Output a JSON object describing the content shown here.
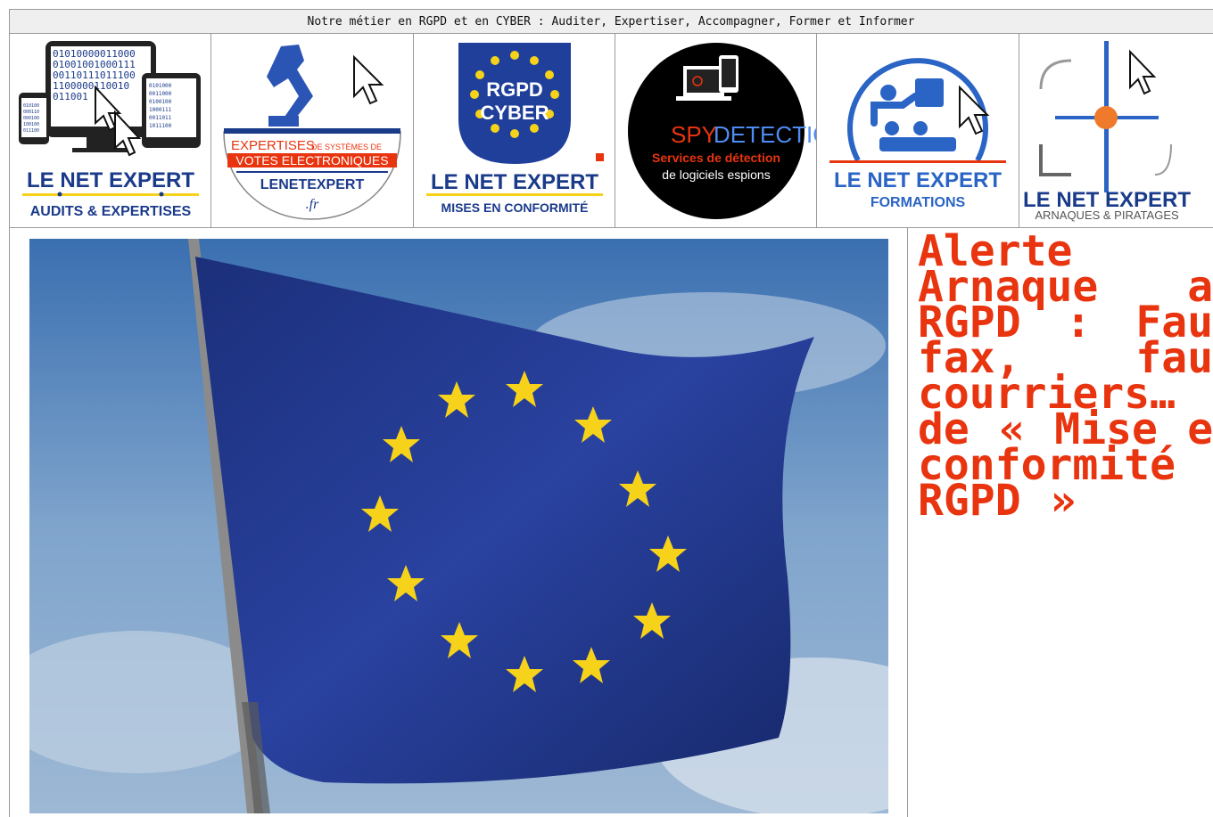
{
  "banner": {
    "text": "Notre métier en RGPD et en CYBER : Auditer, Expertiser, Accompagner, Former et Informer"
  },
  "logos": [
    {
      "title": "LE NET EXPERT",
      "subtitle": "AUDITS & EXPERTISES",
      "binary": [
        "01010000011000",
        "01001001000111",
        "00110111011100",
        "1100000110010",
        "011001",
        "0101000",
        "0011000",
        "0100100",
        "1000111",
        "0011011",
        "1011100",
        "010100",
        "000110",
        "000100",
        "100100",
        "011100"
      ]
    },
    {
      "title_line1": "EXPERTISES",
      "title_line1b": "DE SYSTÈMES DE",
      "title_line2": "VOTES ELECTRONIQUES",
      "brand": "LENETEXPERT",
      "tld": ".fr"
    },
    {
      "badge_top": "RGPD",
      "badge_bottom": "CYBER",
      "title": "LE NET EXPERT",
      "subtitle": "MISES EN CONFORMITÉ"
    },
    {
      "title_a": "SPY",
      "title_b": "DETECTION",
      "line1": "Services de détection",
      "line2": "de logiciels espions"
    },
    {
      "title": "LE NET EXPERT",
      "subtitle": "FORMATIONS"
    },
    {
      "title": "LE NET EXPERT",
      "subtitle": "ARNAQUES & PIRATAGES"
    }
  ],
  "article": {
    "title": "Alerte Arnaque au RGPD : Faux fax, faux courriers… de « Mise en conformité RGPD »"
  },
  "colors": {
    "accent_red": "#e8340f",
    "eu_blue": "#1f3f9a",
    "eu_gold": "#f6d21a",
    "navy": "#1a3a8a"
  }
}
